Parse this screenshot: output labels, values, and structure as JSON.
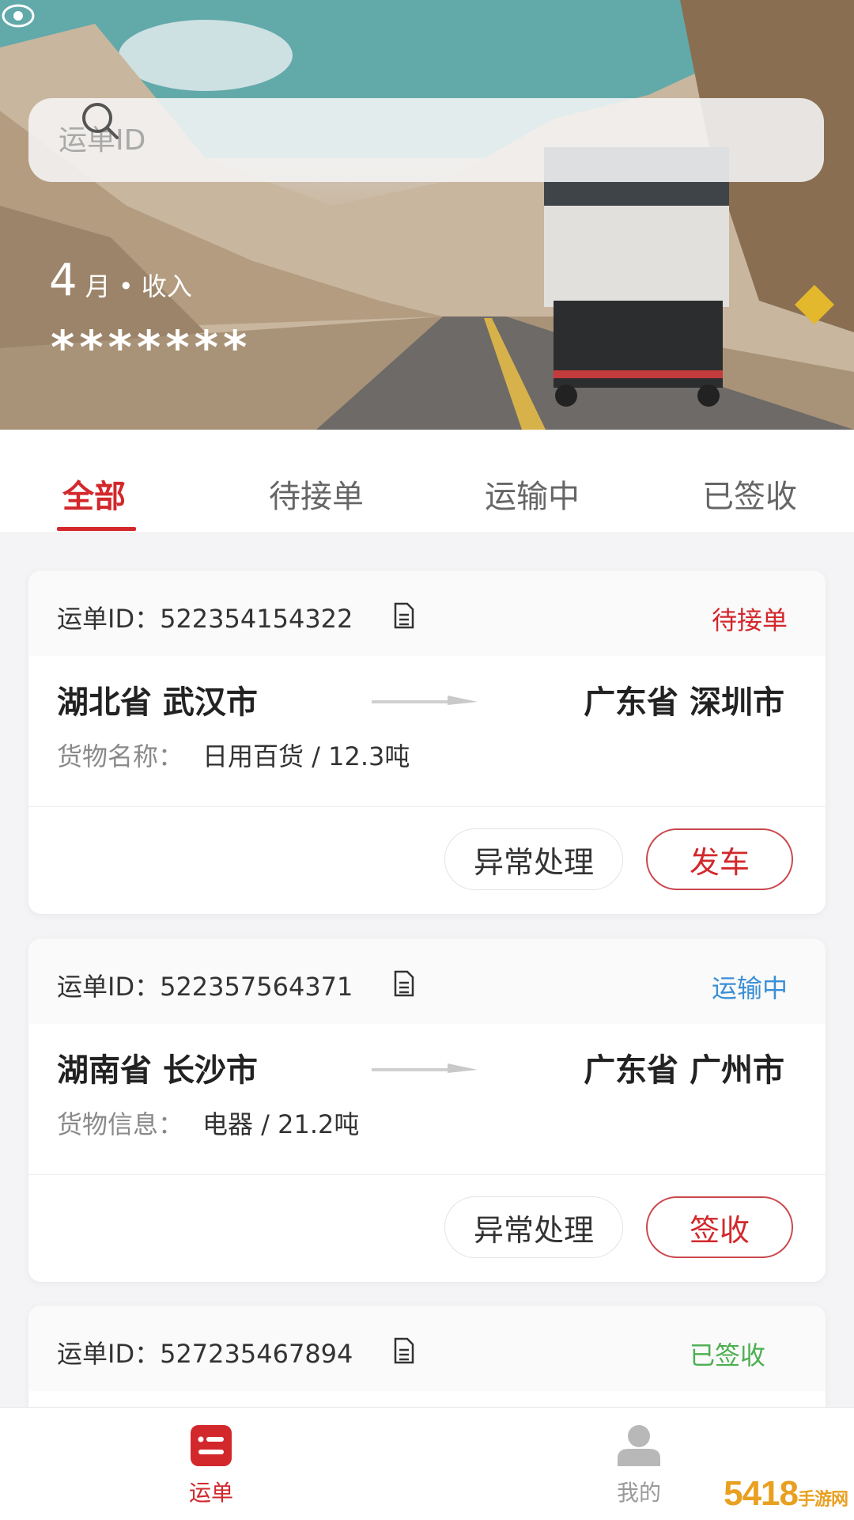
{
  "search": {
    "placeholder": "运单ID"
  },
  "summary": {
    "month": "4",
    "label": "月 • 收入",
    "masked_value": "*******"
  },
  "tabs": [
    {
      "label": "全部",
      "active": true
    },
    {
      "label": "待接单",
      "active": false
    },
    {
      "label": "运输中",
      "active": false
    },
    {
      "label": "已签收",
      "active": false
    }
  ],
  "orders": [
    {
      "id_text": "运单ID：522354154322",
      "status": "待接单",
      "status_color": "#d2282c",
      "from": "湖北省  武汉市",
      "to": "广东省  深圳市",
      "goods_label": "货物名称：",
      "goods_value": "日用百货 / 12.3吨",
      "secondary_action": "异常处理",
      "primary_action": "发车"
    },
    {
      "id_text": "运单ID：522357564371",
      "status": "运输中",
      "status_color": "#3a8fd6",
      "from": "湖南省  长沙市",
      "to": "广东省  广州市",
      "goods_label": "货物信息：",
      "goods_value": "电器 / 21.2吨",
      "secondary_action": "异常处理",
      "primary_action": "签收"
    },
    {
      "id_text": "运单ID：527235467894",
      "status": "已签收",
      "status_color": "#4caf50"
    }
  ],
  "bottom_nav": [
    {
      "label": "运单",
      "icon": "list-icon",
      "active": true,
      "color": "#d2282c"
    },
    {
      "label": "我的",
      "icon": "user-icon",
      "active": false,
      "color": "#9a9a9a"
    }
  ],
  "watermark": {
    "text": "5418",
    "suffix": "手游网"
  }
}
